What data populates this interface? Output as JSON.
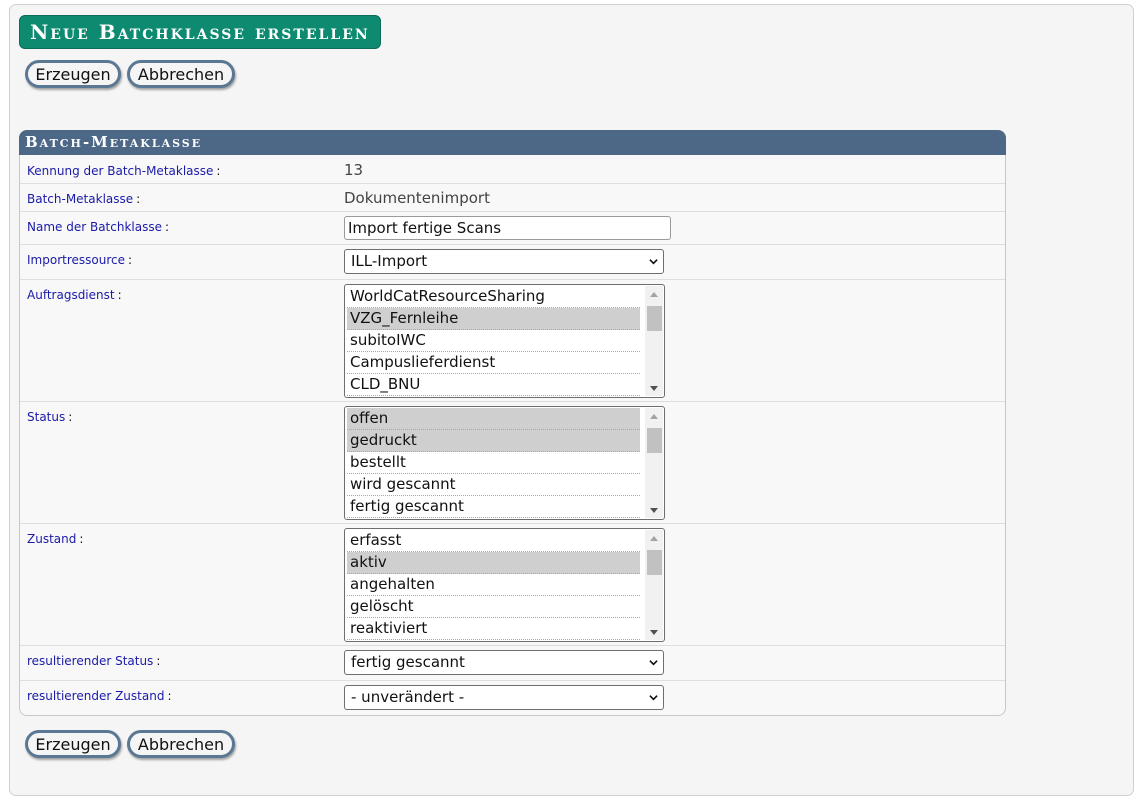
{
  "page": {
    "title": "Neue Batchklasse erstellen",
    "buttons": {
      "create": "Erzeugen",
      "cancel": "Abbrechen"
    }
  },
  "panel": {
    "header": "Batch-Metaklasse",
    "colon": ":",
    "fields": {
      "id": {
        "label": "Kennung der Batch-Metaklasse",
        "value": "13"
      },
      "metaclass": {
        "label": "Batch-Metaklasse",
        "value": "Dokumentenimport"
      },
      "name": {
        "label": "Name der Batchklasse",
        "value": "Import fertige Scans"
      },
      "import_resource": {
        "label": "Importressource",
        "selected": "ILL-Import"
      },
      "service": {
        "label": "Auftragsdienst",
        "options": [
          "WorldCatResourceSharing",
          "VZG_Fernleihe",
          "subitoIWC",
          "Campuslieferdienst",
          "CLD_BNU"
        ],
        "selected": [
          "VZG_Fernleihe"
        ]
      },
      "status": {
        "label": "Status",
        "options": [
          "offen",
          "gedruckt",
          "bestellt",
          "wird gescannt",
          "fertig gescannt"
        ],
        "selected": [
          "offen",
          "gedruckt"
        ]
      },
      "state": {
        "label": "Zustand",
        "options": [
          "erfasst",
          "aktiv",
          "angehalten",
          "gelöscht",
          "reaktiviert"
        ],
        "selected": [
          "aktiv"
        ]
      },
      "result_status": {
        "label": "resultierender Status",
        "selected": "fertig gescannt"
      },
      "result_state": {
        "label": "resultierender Zustand",
        "selected": "- unverändert -"
      }
    }
  },
  "icons": {
    "dropdown": "chevron-down-icon",
    "scroll_up": "scroll-up-arrow-icon",
    "scroll_down": "scroll-down-arrow-icon"
  },
  "colors": {
    "title_bg": "#0d8a70",
    "header_bg": "#4d6886",
    "label_text": "#1a1aa8",
    "button_border": "#5a7894",
    "selected_option": "#cfcfcf"
  }
}
